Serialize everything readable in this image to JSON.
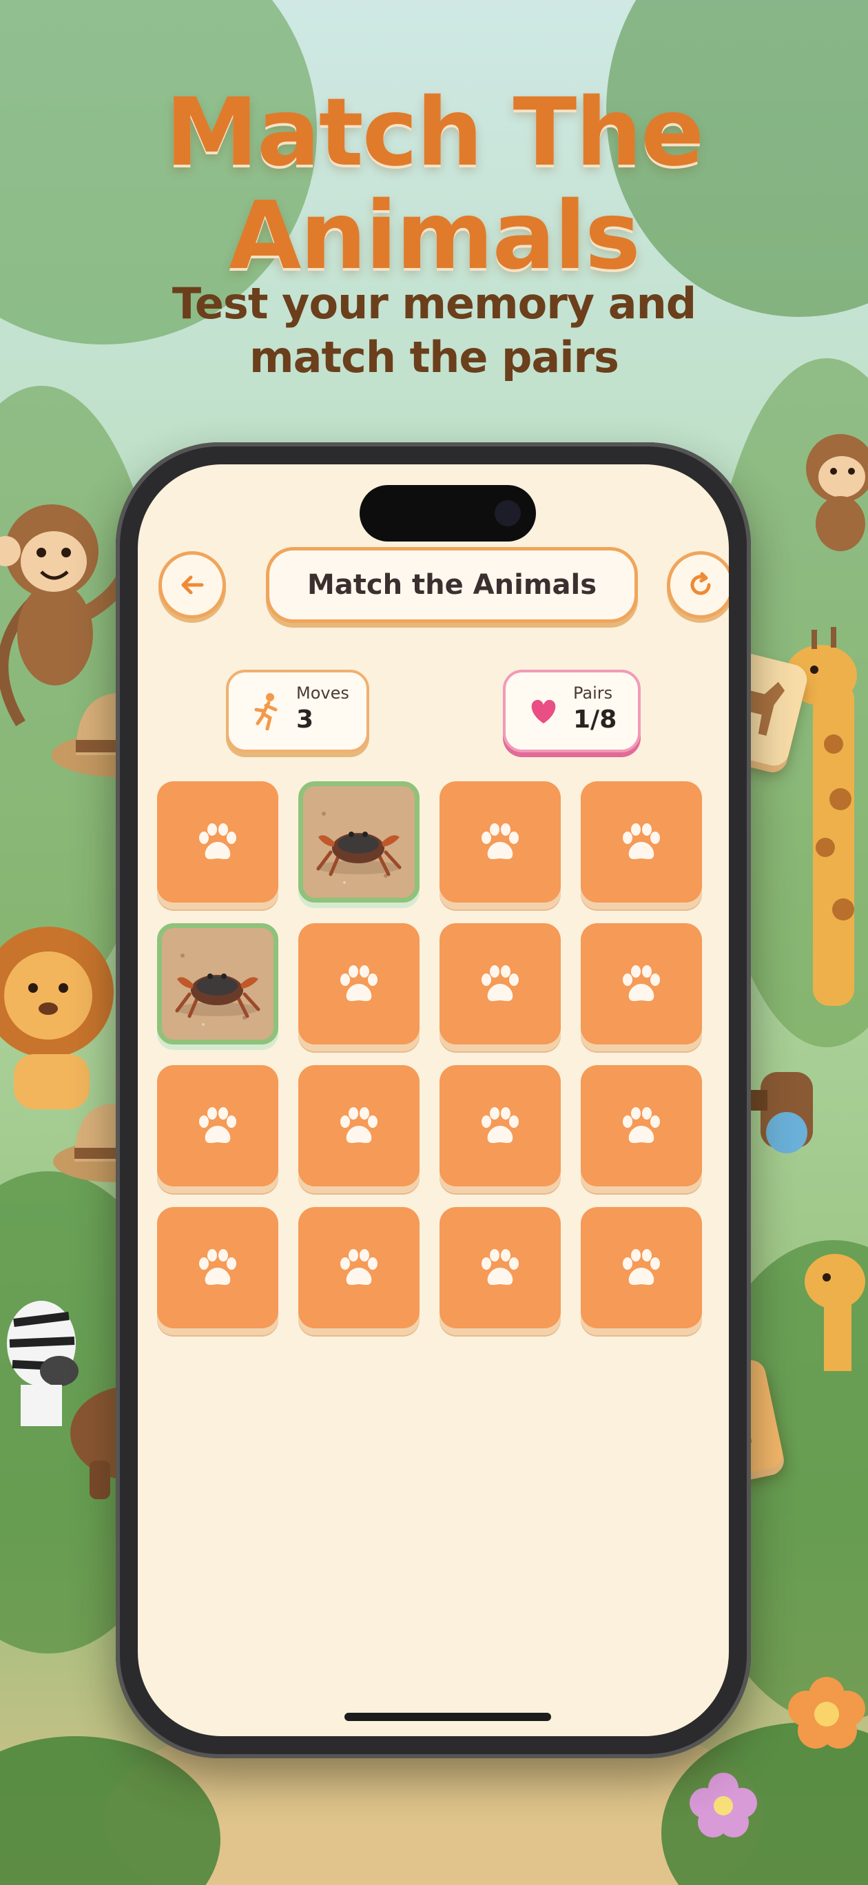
{
  "headline": {
    "line1": "Match The",
    "line2": "Animals"
  },
  "subheadline": {
    "line1": "Test your memory and",
    "line2": "match the pairs"
  },
  "app": {
    "title": "Match the Animals",
    "back_icon": "arrow-left-icon",
    "restart_icon": "restart-icon",
    "moves": {
      "label": "Moves",
      "value": "3",
      "icon": "running-person-icon"
    },
    "pairs": {
      "label": "Pairs",
      "value": "1/8",
      "icon": "heart-icon"
    }
  },
  "board": {
    "rows": 4,
    "cols": 4,
    "cards": [
      {
        "state": "hidden"
      },
      {
        "state": "revealed",
        "animal": "crab"
      },
      {
        "state": "hidden"
      },
      {
        "state": "hidden"
      },
      {
        "state": "revealed",
        "animal": "crab"
      },
      {
        "state": "hidden"
      },
      {
        "state": "hidden"
      },
      {
        "state": "hidden"
      },
      {
        "state": "hidden"
      },
      {
        "state": "hidden"
      },
      {
        "state": "hidden"
      },
      {
        "state": "hidden"
      },
      {
        "state": "hidden"
      },
      {
        "state": "hidden"
      },
      {
        "state": "hidden"
      },
      {
        "state": "hidden"
      }
    ],
    "card_back_icon": "paw-icon"
  },
  "colors": {
    "accent": "#e07b2c",
    "card_orange": "#f59a57",
    "matched_border": "#8fc27a",
    "heart_pink": "#e94e84",
    "screen_bg": "#fbf1dd"
  }
}
